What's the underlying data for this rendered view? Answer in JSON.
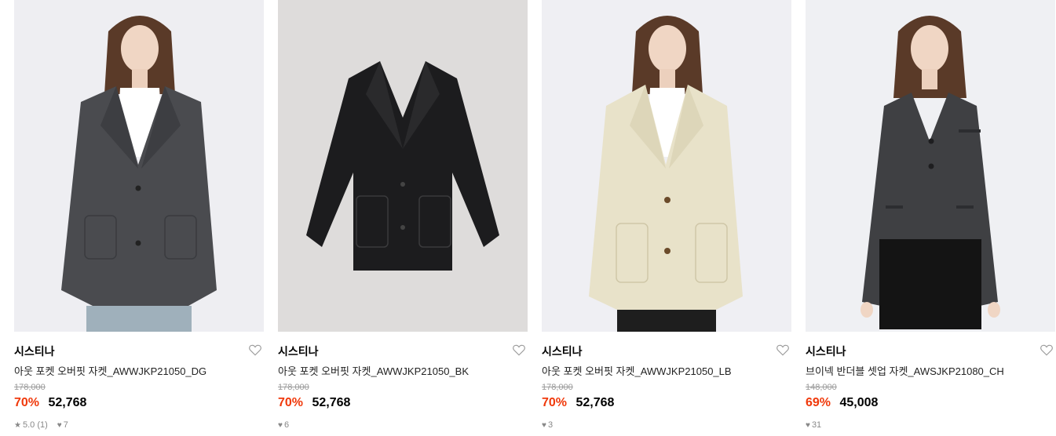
{
  "colors": {
    "discount": "#f0390b",
    "original_price": "#9a9a9a",
    "meta": "#888888"
  },
  "products": [
    {
      "brand": "시스티나",
      "name": "아웃 포켓 오버핏 자켓_AWWJKP21050_DG",
      "original_price": "178,000",
      "discount": "70%",
      "price": "52,768",
      "rating": "5.0 (1)",
      "likes": "7",
      "image": "model-dark-grey-jacket"
    },
    {
      "brand": "시스티나",
      "name": "아웃 포켓 오버핏 자켓_AWWJKP21050_BK",
      "original_price": "178,000",
      "discount": "70%",
      "price": "52,768",
      "likes": "6",
      "image": "black-jacket-flatlay"
    },
    {
      "brand": "시스티나",
      "name": "아웃 포켓 오버핏 자켓_AWWJKP21050_LB",
      "original_price": "178,000",
      "discount": "70%",
      "price": "52,768",
      "likes": "3",
      "image": "model-beige-jacket"
    },
    {
      "brand": "시스티나",
      "name": "브이넥 반더블 셋업 자켓_AWSJKP21080_CH",
      "original_price": "148,000",
      "discount": "69%",
      "price": "45,008",
      "likes": "31",
      "image": "model-charcoal-vneck-jacket"
    }
  ]
}
